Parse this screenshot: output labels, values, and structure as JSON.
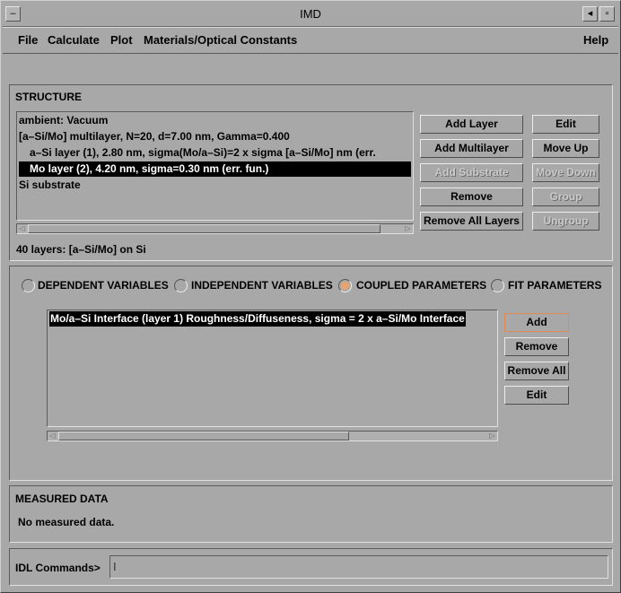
{
  "window": {
    "title": "IMD",
    "controls": [
      "◂",
      "▫"
    ]
  },
  "menu": {
    "file": "File",
    "calculate": "Calculate",
    "plot": "Plot",
    "materials": "Materials/Optical Constants",
    "help": "Help"
  },
  "structure": {
    "label": "STRUCTURE",
    "rows": [
      "ambient: Vacuum",
      "[a–Si/Mo] multilayer, N=20, d=7.00 nm, Gamma=0.400",
      "  a–Si layer (1), 2.80 nm, sigma(Mo/a–Si)=2 x sigma [a–Si/Mo] nm (err.",
      "  Mo layer (2), 4.20 nm, sigma=0.30 nm (err. fun.)",
      "Si substrate"
    ],
    "selected_index": 3,
    "summary": "40 layers: [a–Si/Mo] on Si",
    "buttons": {
      "add_layer": "Add Layer",
      "add_multilayer": "Add Multilayer",
      "add_substrate": "Add Substrate",
      "remove": "Remove",
      "remove_all": "Remove All Layers",
      "edit": "Edit",
      "move_up": "Move Up",
      "move_down": "Move Down",
      "group": "Group",
      "ungroup": "Ungroup"
    }
  },
  "variables": {
    "options": {
      "dependent": "DEPENDENT VARIABLES",
      "independent": "INDEPENDENT VARIABLES",
      "coupled": "COUPLED PARAMETERS",
      "fit": "FIT PARAMETERS"
    },
    "selected": "coupled",
    "list": [
      "Mo/a–Si Interface (layer 1) Roughness/Diffuseness, sigma = 2 x a–Si/Mo Interface"
    ],
    "buttons": {
      "add": "Add",
      "remove": "Remove",
      "remove_all": "Remove All",
      "edit": "Edit"
    }
  },
  "measured": {
    "label": "MEASURED DATA",
    "status": "No measured data."
  },
  "idl": {
    "label": "IDL Commands>",
    "value": ""
  }
}
